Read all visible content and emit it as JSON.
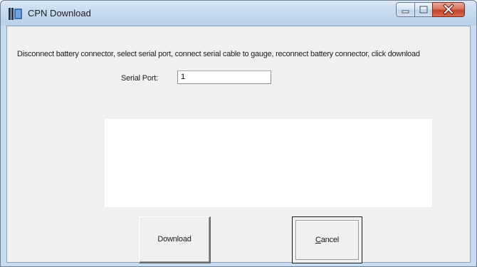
{
  "window": {
    "title": "CPN Download",
    "icon": "cpn-app-icon",
    "controls": [
      "minimize-icon",
      "maximize-icon",
      "close-icon"
    ]
  },
  "content": {
    "instructions": "Disconnect battery connector, select serial port, connect serial cable to gauge, reconnect battery connector, click download",
    "serial_port_label": "Serial Port:",
    "serial_port_value": "1"
  },
  "buttons": {
    "download_label": "Download",
    "cancel_accelerator": "C",
    "cancel_rest": "ancel"
  },
  "colors": {
    "titlebar": "#c7daee",
    "client_background": "#f0f0f0",
    "close_button": "#c5432b"
  }
}
